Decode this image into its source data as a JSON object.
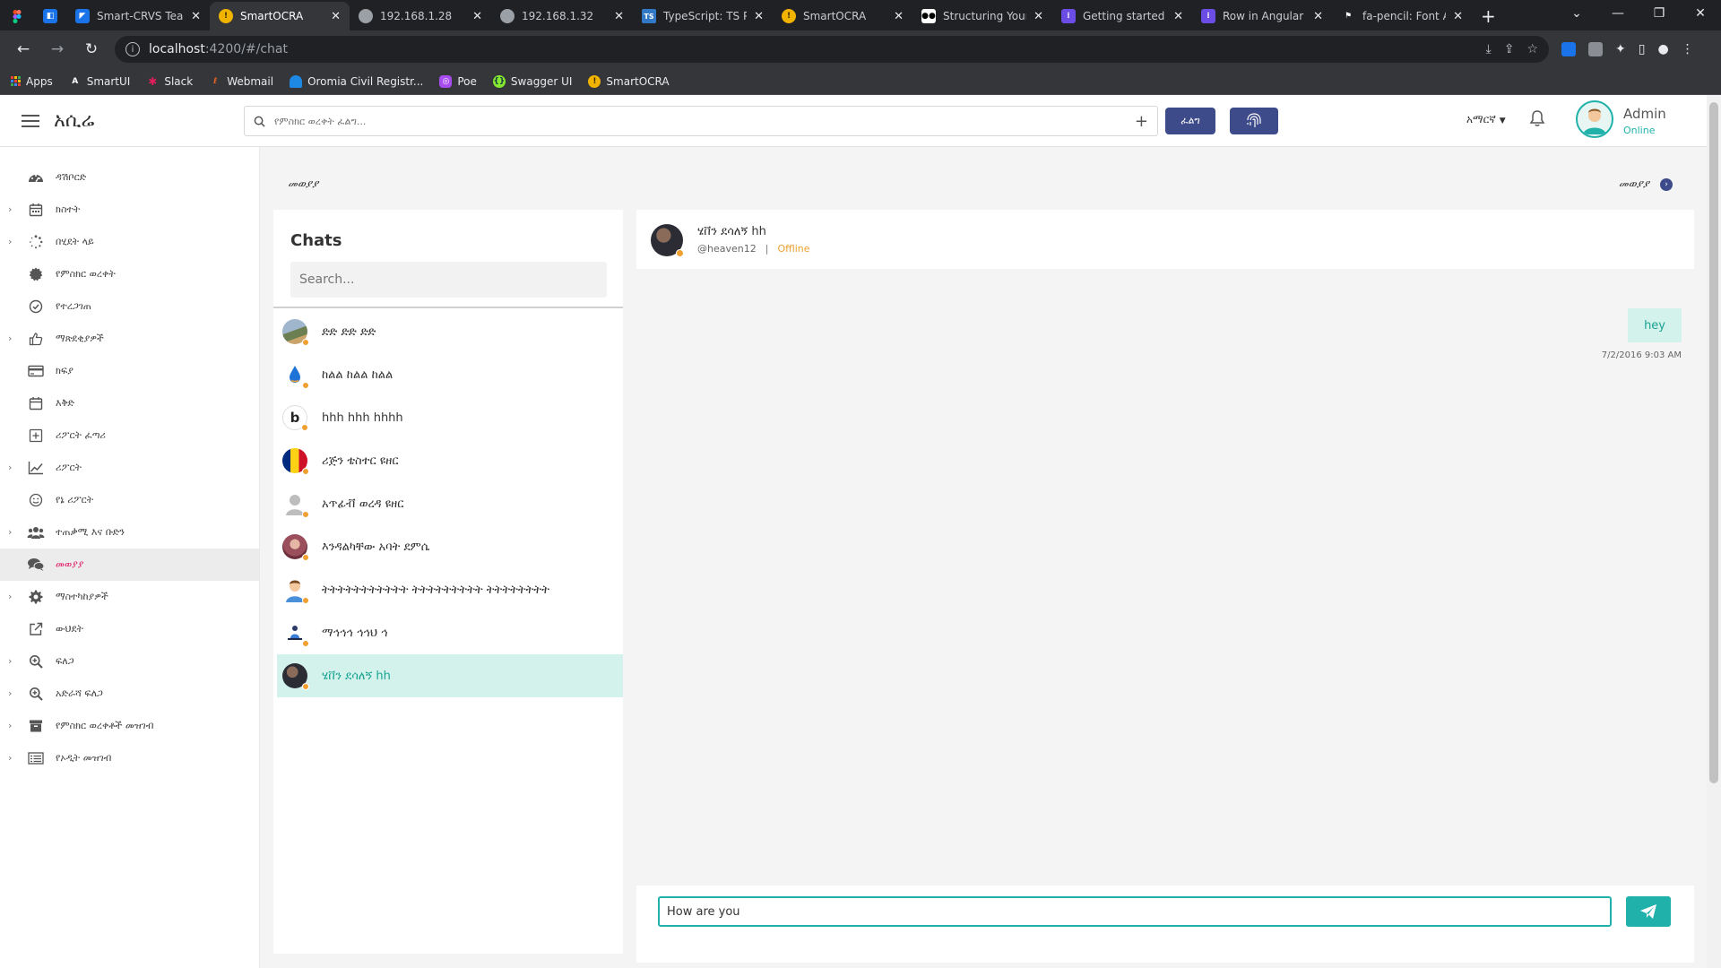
{
  "browser": {
    "tabs": [
      {
        "label": "",
        "icon": "figma-icon"
      },
      {
        "label": "",
        "icon": "vscode-icon"
      },
      {
        "label": "Smart-CRVS Tea",
        "icon": "azure-devops-icon"
      },
      {
        "label": "SmartOCRA",
        "icon": "smartocra-icon",
        "active": true
      },
      {
        "label": "192.168.1.28",
        "icon": "globe-icon"
      },
      {
        "label": "192.168.1.32",
        "icon": "globe-icon"
      },
      {
        "label": "TypeScript: TS Pl",
        "icon": "typescript-icon"
      },
      {
        "label": "SmartOCRA",
        "icon": "smartocra-icon"
      },
      {
        "label": "Structuring Your",
        "icon": "medium-icon"
      },
      {
        "label": "Getting started v",
        "icon": "docs-icon"
      },
      {
        "label": "Row in Angular (",
        "icon": "docs-icon"
      },
      {
        "label": "fa-pencil: Font A",
        "icon": "flag-icon"
      }
    ],
    "url_host": "localhost",
    "url_path": ":4200/#/chat",
    "bookmarks": [
      "Apps",
      "SmartUI",
      "Slack",
      "Webmail",
      "Oromia Civil Registr...",
      "Poe",
      "Swagger UI",
      "SmartOCRA"
    ]
  },
  "header": {
    "brand": "አሲሬ",
    "search_placeholder": "የምስክር ወረቀት ፈልግ...",
    "search_button": "ፈልግ",
    "language": "አማርኛ",
    "user_name": "Admin",
    "user_status": "Online"
  },
  "sidebar": {
    "items": [
      {
        "label": "ዳሽቦርድ",
        "icon": "dashboard-icon",
        "chevron": false
      },
      {
        "label": "ክስተት",
        "icon": "calendar-icon",
        "chevron": true
      },
      {
        "label": "በሂደት ላይ",
        "icon": "spinner-icon",
        "chevron": true
      },
      {
        "label": "የምስክር ወረቀት",
        "icon": "certificate-icon",
        "chevron": false
      },
      {
        "label": "የተረጋገጠ",
        "icon": "check-circle-icon",
        "chevron": false
      },
      {
        "label": "ማጽደቂያዎች",
        "icon": "thumbs-up-icon",
        "chevron": true
      },
      {
        "label": "ክፍያ",
        "icon": "credit-card-icon",
        "chevron": false
      },
      {
        "label": "እቅድ",
        "icon": "calendar-plan-icon",
        "chevron": false
      },
      {
        "label": "ሪፖርት ፈጣሪ",
        "icon": "plus-square-icon",
        "chevron": false
      },
      {
        "label": "ሪፖርት",
        "icon": "line-chart-icon",
        "chevron": true
      },
      {
        "label": "የኔ ሪፖርት",
        "icon": "smile-icon",
        "chevron": false
      },
      {
        "label": "ተጠቃሚ እና ቡድን",
        "icon": "users-icon",
        "chevron": true
      },
      {
        "label": "መወያያ",
        "icon": "chat-icon",
        "chevron": false,
        "active": true
      },
      {
        "label": "ማስተካከያዎች",
        "icon": "settings-icon",
        "chevron": true
      },
      {
        "label": "ውህደት",
        "icon": "external-link-icon",
        "chevron": false
      },
      {
        "label": "ፍለጋ",
        "icon": "zoom-icon",
        "chevron": true
      },
      {
        "label": "አድራሻ ፍለጋ",
        "icon": "zoom-address-icon",
        "chevron": true
      },
      {
        "label": "የምስክር ወረቀቶች መዝገብ",
        "icon": "archive-icon",
        "chevron": true
      },
      {
        "label": "የኦዲት መዝገብ",
        "icon": "list-icon",
        "chevron": true
      }
    ]
  },
  "page": {
    "breadcrumb_left": "መወያያ",
    "breadcrumb_right": "መወያያ"
  },
  "chats": {
    "title": "Chats",
    "search_placeholder": "Search...",
    "list": [
      {
        "name": "ድድ ድድ ድድ",
        "avatar_color": "#8fa8c0",
        "avatar_icon": "landscape-avatar"
      },
      {
        "name": "ከልል ከልል ከልል",
        "avatar_color": "#ffffff",
        "avatar_icon": "drop-avatar"
      },
      {
        "name": "hhh hhh hhhh",
        "avatar_color": "#ffffff",
        "avatar_icon": "b-logo-avatar"
      },
      {
        "name": "ሪጅን ቴስተር ዩዘር",
        "avatar_color": "#fcd116",
        "avatar_icon": "flag-avatar"
      },
      {
        "name": "አጥፊቭ ወረዳ ዩዘር",
        "avatar_color": "#c8c8c8",
        "avatar_icon": "default-user-avatar"
      },
      {
        "name": "እንዳልካቸው አባት ደምሴ",
        "avatar_color": "#b5707a",
        "avatar_icon": "photo-avatar"
      },
      {
        "name": "ትትትትትትትትትትት ትትትትትትትትት ትትትትትትትት",
        "avatar_color": "#fbe3c8",
        "avatar_icon": "cartoon-user-avatar"
      },
      {
        "name": "ማኅኅኅ ኅኅህ ኅ",
        "avatar_color": "#ffffff",
        "avatar_icon": "person-avatar"
      },
      {
        "name": "ሄቨን ደሳለኝ hh",
        "avatar_color": "#2c2c34",
        "avatar_icon": "photo-avatar",
        "active": true
      }
    ]
  },
  "conversation": {
    "name": "ሄቨን ደሳለኝ hh",
    "handle": "@heaven12",
    "separator": "|",
    "status": "Offline",
    "messages": [
      {
        "text": "hey",
        "time": "7/2/2016  9:03 AM",
        "outgoing": true
      }
    ],
    "input_value": "How are you"
  },
  "colors": {
    "accent": "#20b2aa",
    "primary": "#3e4b8b",
    "active_sidebar_text": "#e0226b",
    "offline": "#f0a030"
  }
}
